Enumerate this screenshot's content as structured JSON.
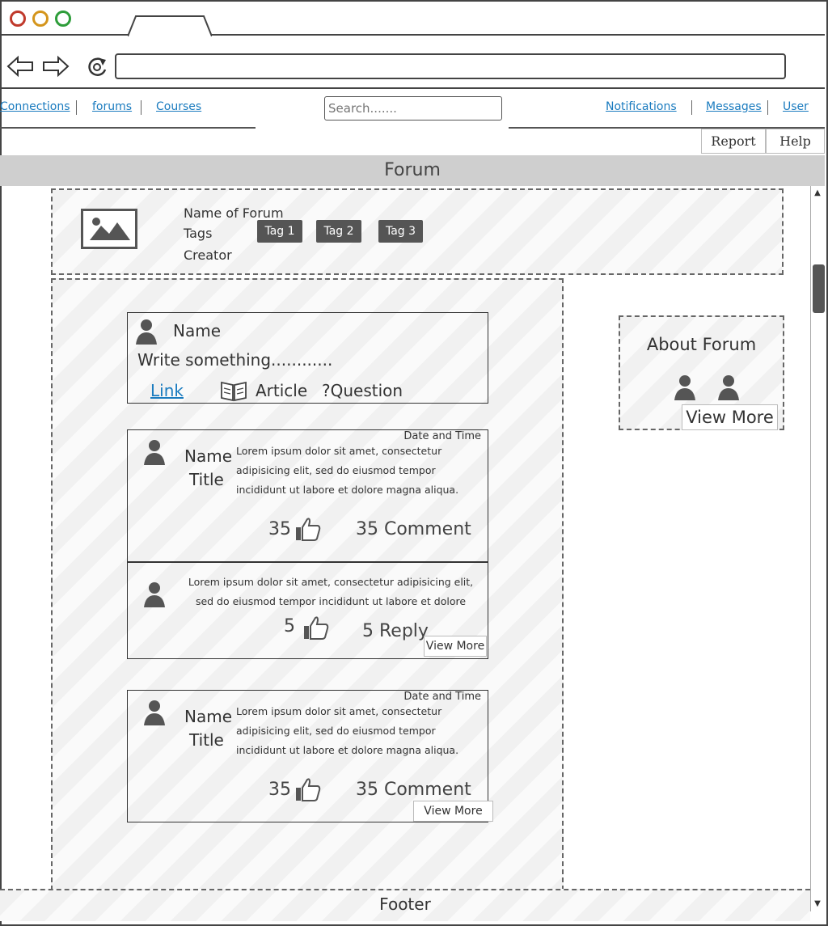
{
  "nav": {
    "connections": "Connections",
    "forums": "forums",
    "courses": "Courses",
    "notifications": "Notifications",
    "messages": "Messages",
    "user": "User"
  },
  "search": {
    "placeholder": "Search......."
  },
  "buttons": {
    "report": "Report",
    "help": "Help"
  },
  "page_title": "Forum",
  "forum_header": {
    "name_label": "Name of Forum",
    "tags_label": "Tags",
    "creator_label": "Creator",
    "tags": [
      "Tag 1",
      "Tag 2",
      "Tag 3"
    ]
  },
  "composer": {
    "name": "Name",
    "placeholder": "Write something............",
    "link": "Link",
    "article": "Article",
    "question": "?Question"
  },
  "posts": [
    {
      "datetime": "Date and Time",
      "name": "Name",
      "title": "Title",
      "body": "Lorem ipsum dolor sit amet, consectetur adipisicing elit, sed do eiusmod tempor incididunt ut labore et dolore magna aliqua.",
      "likes": "35",
      "comments": "35  Comment"
    },
    {
      "datetime": "Date and Time",
      "name": "Name",
      "title": "Title",
      "body": "Lorem ipsum dolor sit amet, consectetur adipisicing elit, sed do eiusmod tempor incididunt ut labore et dolore magna aliqua.",
      "likes": "35",
      "comments": "35  Comment",
      "view_more": "View More"
    }
  ],
  "reply": {
    "body": "Lorem ipsum dolor sit amet, consectetur adipisicing elit, sed do eiusmod tempor incididunt ut labore et dolore",
    "likes": "5",
    "replies": "5 Reply",
    "view_more": "View More"
  },
  "about": {
    "title": "About Forum",
    "view_more": "View More"
  },
  "footer": "Footer",
  "icons": [
    "back-arrow-icon",
    "forward-arrow-icon",
    "reload-icon",
    "image-icon",
    "user-icon",
    "book-icon",
    "thumbs-up-icon"
  ]
}
